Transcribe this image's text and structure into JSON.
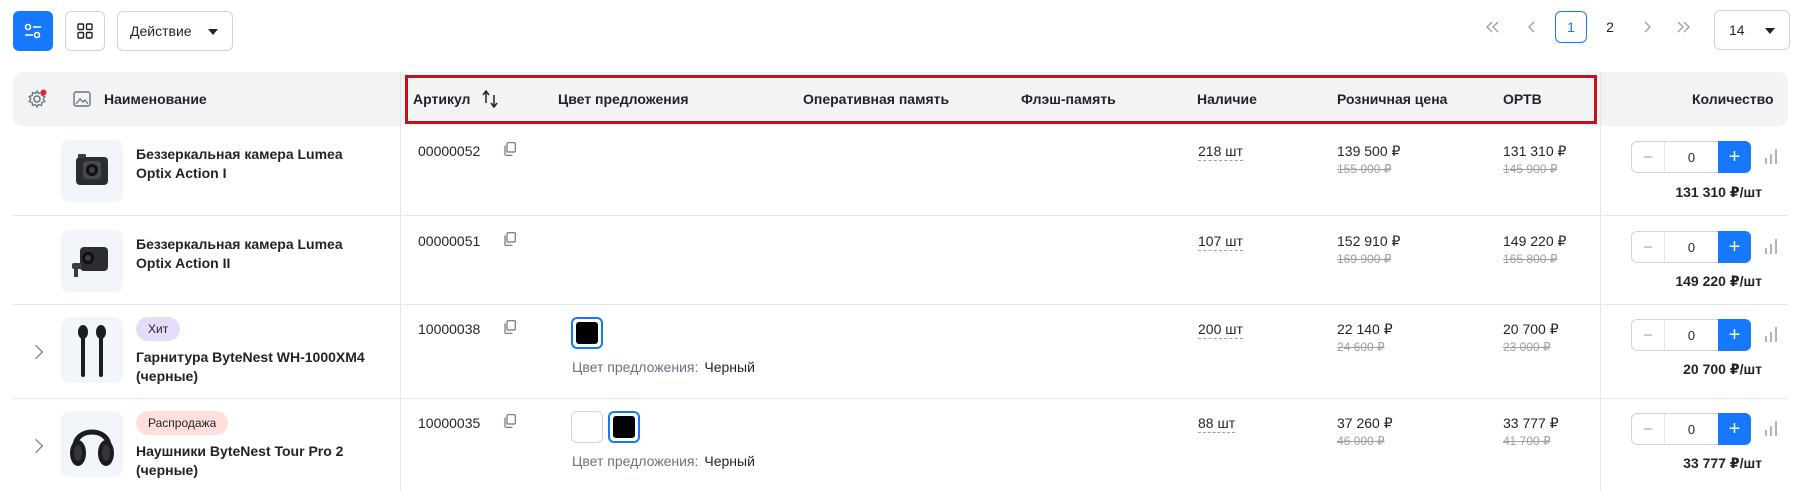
{
  "toolbar": {
    "action_label": "Действие"
  },
  "pagination": {
    "pages": [
      "1",
      "2"
    ],
    "current": "1",
    "page_size": "14"
  },
  "colors": {
    "accent": "#1677ff",
    "highlight_border": "#c0121b",
    "badge_hit": "#e6dcf7",
    "badge_sale": "#fde0dd"
  },
  "table": {
    "headers": {
      "name": "Наименование",
      "sku": "Артикул",
      "color": "Цвет предложения",
      "ram": "Оперативная память",
      "flash": "Флэш-память",
      "stock": "Наличие",
      "retail": "Розничная цена",
      "optv": "ОРТВ",
      "quantity": "Количество"
    },
    "rows": [
      {
        "name": "Беззеркальная камера Lumea Optix Action I",
        "sku": "00000052",
        "stock": "218 шт",
        "retail": "139 500 ₽",
        "retail_old": "155 000 ₽",
        "optv": "131 310 ₽",
        "optv_old": "145 900 ₽",
        "qty": "0",
        "total": "131 310 ₽/шт"
      },
      {
        "name": "Беззеркальная камера Lumea Optix Action II",
        "sku": "00000051",
        "stock": "107 шт",
        "retail": "152 910 ₽",
        "retail_old": "169 900 ₽",
        "optv": "149 220 ₽",
        "optv_old": "165 800 ₽",
        "qty": "0",
        "total": "149 220 ₽/шт"
      },
      {
        "badge": "Хит",
        "name": "Гарнитура ByteNest WH-1000XM4 (черные)",
        "sku": "10000038",
        "color_label": "Цвет предложения:",
        "color_value": "Черный",
        "stock": "200 шт",
        "retail": "22 140 ₽",
        "retail_old": "24 600 ₽",
        "optv": "20 700 ₽",
        "optv_old": "23 000 ₽",
        "qty": "0",
        "total": "20 700 ₽/шт"
      },
      {
        "badge": "Распродажа",
        "name": "Наушники ByteNest Tour Pro 2 (черные)",
        "sku": "10000035",
        "color_label": "Цвет предложения:",
        "color_value": "Черный",
        "stock": "88 шт",
        "retail": "37 260 ₽",
        "retail_old": "46 000 ₽",
        "optv": "33 777 ₽",
        "optv_old": "41 700 ₽",
        "qty": "0",
        "total": "33 777 ₽/шт"
      }
    ]
  }
}
